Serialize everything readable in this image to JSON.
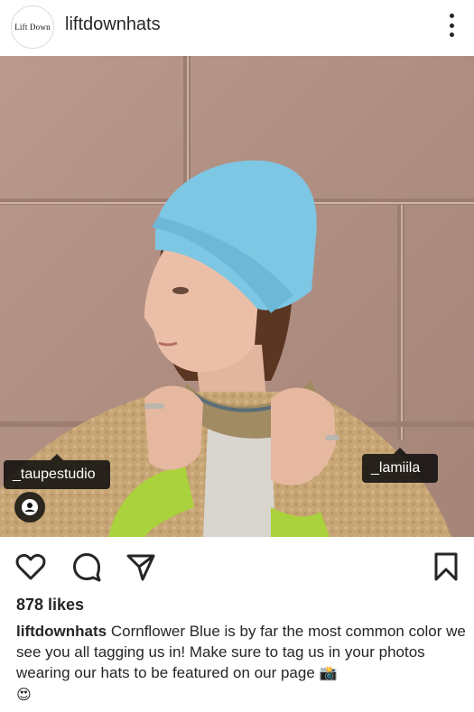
{
  "post": {
    "avatar_text": "Lift Down",
    "username": "liftdownhats",
    "likes": "878 likes",
    "caption_username": "liftdownhats",
    "caption_text": "Cornflower Blue is by far the most common color we see you all tagging us in! Make sure to tag us in your photos wearing our hats to be featured on our page",
    "caption_emoji_1": "📸",
    "caption_emoji_2": "😍"
  },
  "tags": [
    {
      "label": "_taupestudio"
    },
    {
      "label": "_lamiila"
    }
  ],
  "icons": {
    "more": "more-vertical-icon",
    "like": "heart-icon",
    "comment": "comment-icon",
    "share": "share-icon",
    "save": "bookmark-icon",
    "tagged": "user-tag-icon"
  },
  "colors": {
    "wall": "#b6978b",
    "beanie": "#7cc7e3",
    "jacket": "#c9a877",
    "sleeve": "#a9d23c"
  }
}
